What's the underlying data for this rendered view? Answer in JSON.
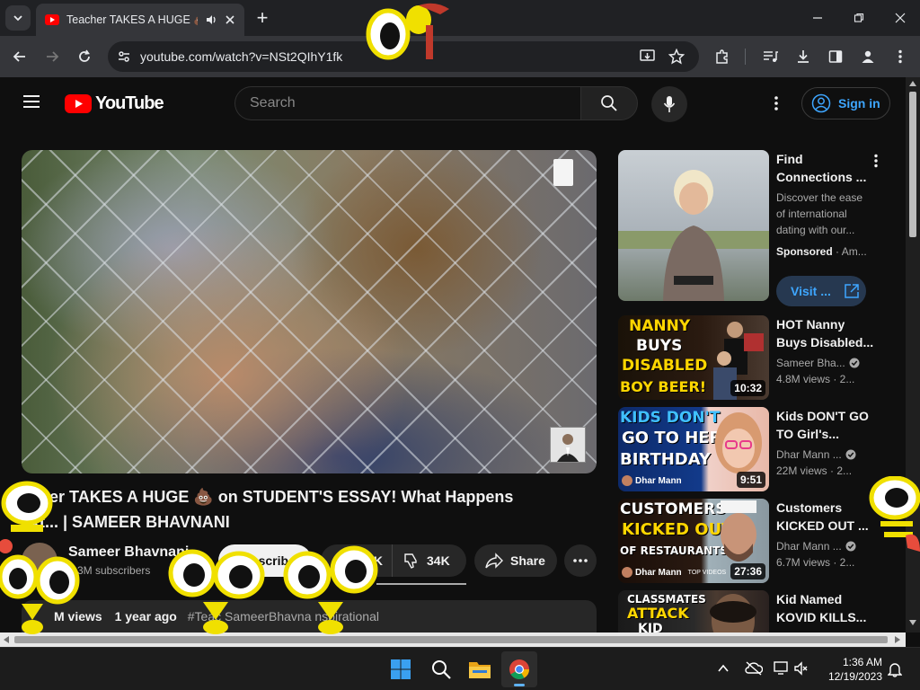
{
  "browser": {
    "tab_title": "Teacher TAKES A HUGE 💩",
    "new_tab": "+",
    "url": "youtube.com/watch?v=NSt2QIhY1fk"
  },
  "youtube": {
    "logo_text": "YouTube",
    "search_placeholder": "Search",
    "sign_in": "Sign in",
    "video": {
      "title": "Teacher TAKES A HUGE 💩 on STUDENT'S ESSAY! What Happens Next... | SAMEER BHAVNANI",
      "title_line1": "acher TAKES A HUGE 💩 on STUDENT'S ESSAY! What Happens",
      "title_line2": "ext... | SAMEER BHAVNANI",
      "channel": "Sameer Bhavnani",
      "subscribers": "3M subscribers",
      "subscribe": "Subscribe",
      "likes": "K",
      "dislikes": "34K",
      "share": "Share",
      "views": "M views",
      "age": "1 year ago",
      "tags": "#Teac  SameerBhavna  nspirational"
    },
    "sidebar": [
      {
        "title": "Find Connections ...",
        "desc": "Discover the ease of international dating with our...",
        "sponsored": "Sponsored",
        "advertiser": "Am...",
        "cta": "Visit ..."
      },
      {
        "title": "HOT Nanny Buys Disabled...",
        "channel": "Sameer Bha...",
        "meta": "4.8M views · 2...",
        "duration": "10:32",
        "thumb_lines": [
          "NANNY",
          "BUYS",
          "DISABLED",
          "BOY BEER!"
        ]
      },
      {
        "title": "Kids DON'T GO TO Girl's...",
        "channel": "Dhar Mann ...",
        "meta": "22M views · 2...",
        "duration": "9:51",
        "thumb_lines": [
          "KIDS DON'T",
          "GO TO HER",
          "BIRTHDAY"
        ],
        "brand": "Dhar Mann"
      },
      {
        "title": "Customers KICKED OUT ...",
        "channel": "Dhar Mann ...",
        "meta": "6.7M views · 2...",
        "duration": "27:36",
        "thumb_lines": [
          "CUSTOMERS",
          "KICKED OUT",
          "OF RESTAURANTS"
        ],
        "brand": "Dhar Mann",
        "brand_sub": "TOP VIDEOS"
      },
      {
        "title": "Kid Named KOVID KILLS...",
        "thumb_lines": [
          "CLASSMATES",
          "ATTACK",
          "KID"
        ]
      }
    ]
  },
  "taskbar": {
    "time": "1:36 AM",
    "date": "12/19/2023"
  },
  "colors": {
    "youtube_red": "#ff0000",
    "link_blue": "#3ea6ff",
    "page_bg": "#0f0f0f",
    "thumb_yellow": "#ffd600"
  }
}
